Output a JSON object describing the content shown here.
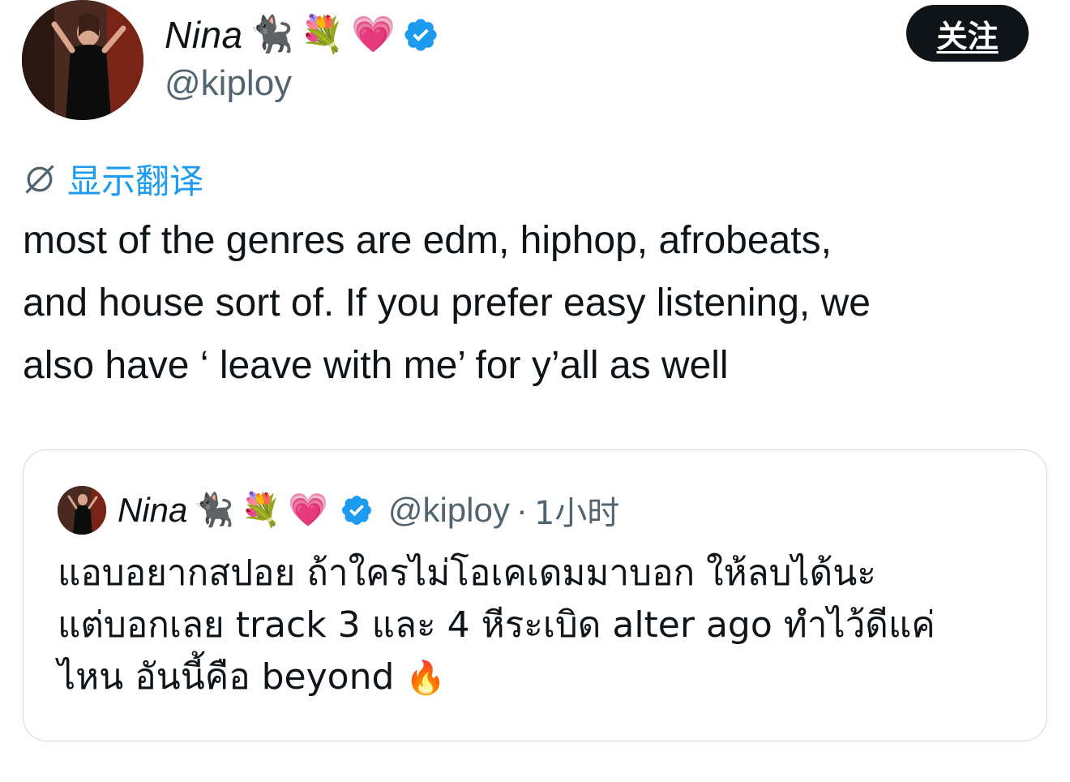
{
  "author": {
    "name": "Nina",
    "handle": "@kiploy",
    "emoji_cat": "🐈‍⬛",
    "emoji_bouquet": "💐",
    "emoji_heart": "💗",
    "verified_icon": "verified-badge-icon"
  },
  "follow_label": "关注",
  "translate_label": "显示翻译",
  "tweet_lines": [
    "most of the genres are edm, hiphop, afrobeats,",
    "and house sort of. If you prefer easy listening, we",
    "also have ‘ leave with me’ for y’all as well"
  ],
  "quote": {
    "name": "Nina",
    "emoji_cat": "🐈‍⬛",
    "emoji_bouquet": "💐",
    "emoji_heart": "💗",
    "handle": "@kiploy",
    "separator": "·",
    "time": "1小时",
    "lines": [
      "แอบอยากสปอย ถ้าใครไม่โอเคเดมมาบอก ให้ลบได้นะ",
      "แต่บอกเลย track 3 และ 4 หีระเบิด alter ago ทำไว้ดีแค่",
      "ไหน อันนี้คือ beyond"
    ],
    "emoji_fire": "🔥"
  },
  "colors": {
    "accent_blue": "#1d9bf0",
    "text_primary": "#0f1419",
    "text_secondary": "#536471",
    "border": "#cfd9de"
  }
}
